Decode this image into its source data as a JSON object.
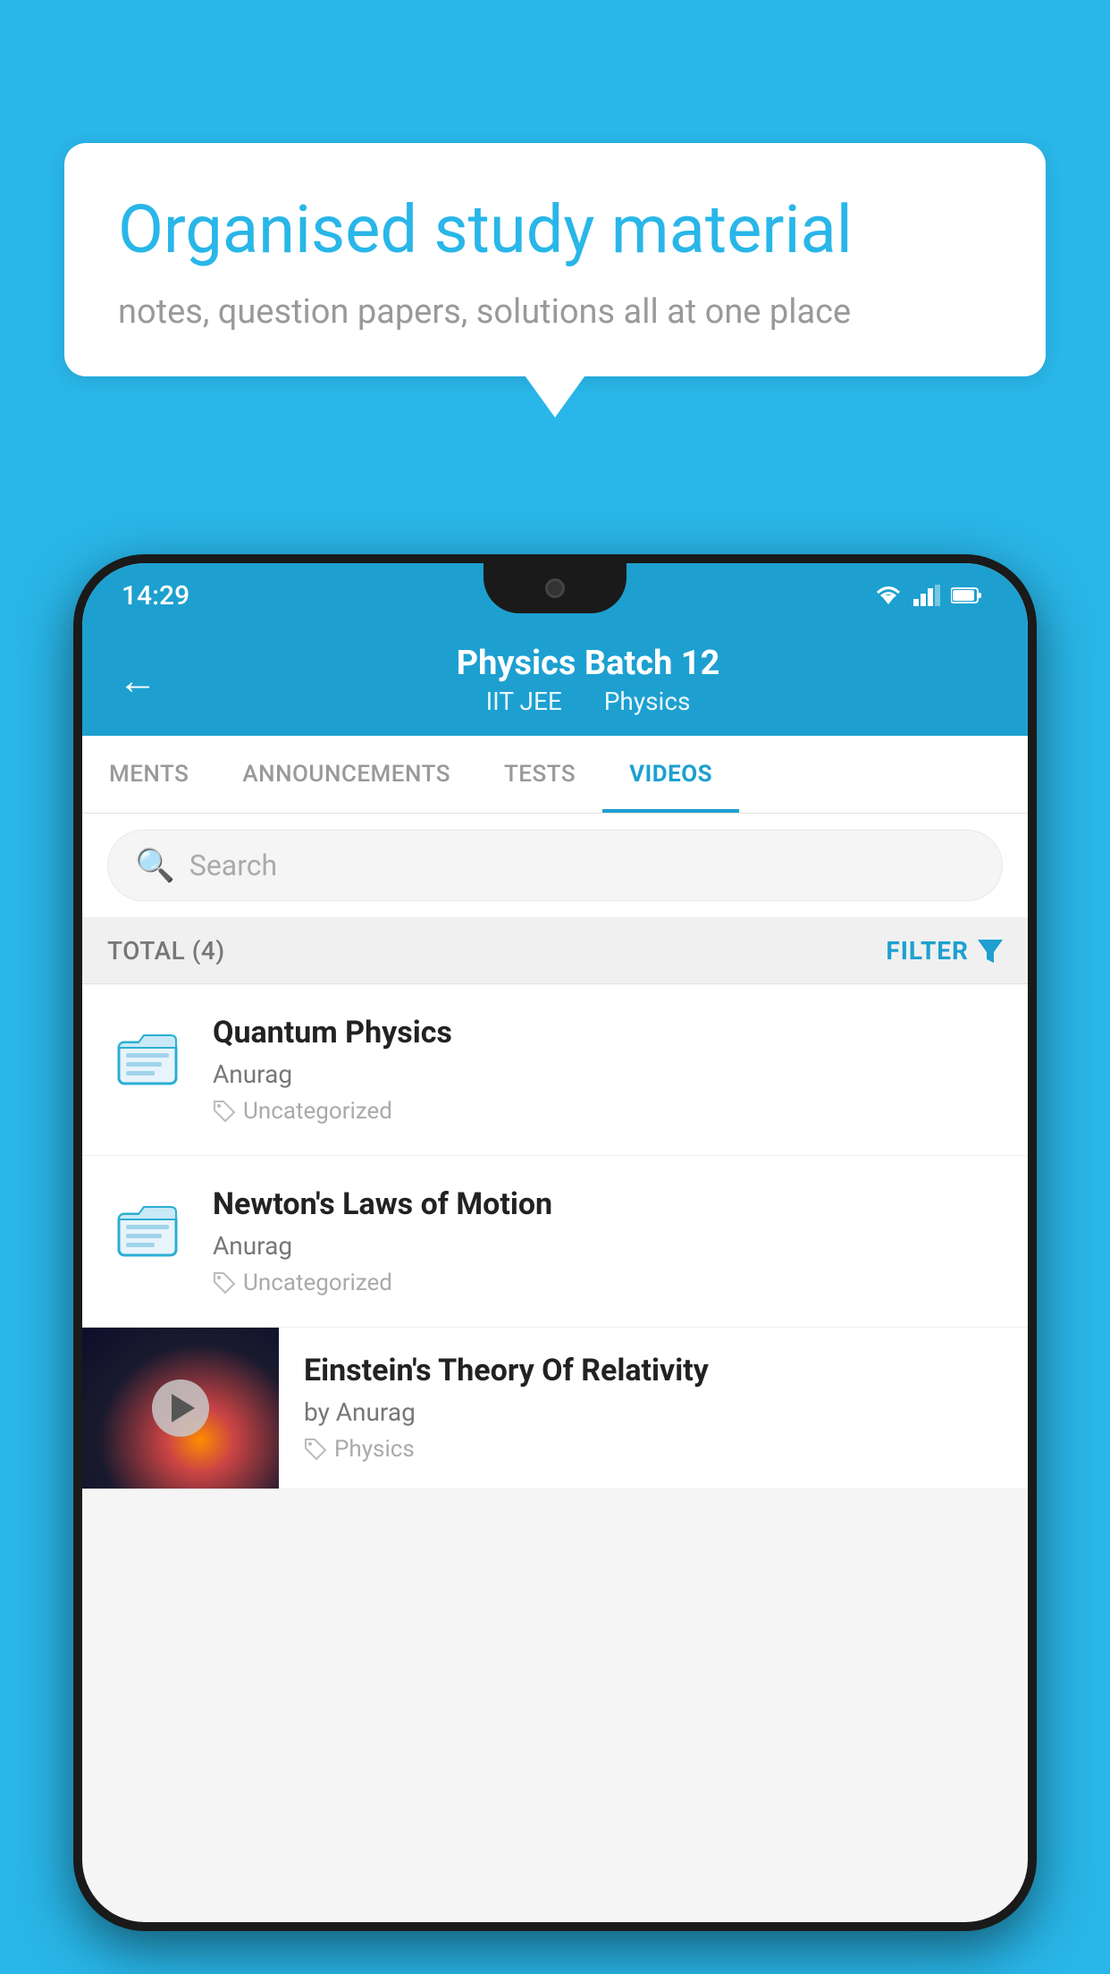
{
  "background_color": "#29b6e8",
  "bubble": {
    "title": "Organised study material",
    "subtitle": "notes, question papers, solutions all at one place"
  },
  "status_bar": {
    "time": "14:29",
    "wifi": "▾",
    "signal": "◂",
    "battery": "▮"
  },
  "header": {
    "title": "Physics Batch 12",
    "subtitle_left": "IIT JEE",
    "subtitle_right": "Physics",
    "back_label": "←"
  },
  "tabs": [
    {
      "label": "MENTS",
      "active": false
    },
    {
      "label": "ANNOUNCEMENTS",
      "active": false
    },
    {
      "label": "TESTS",
      "active": false
    },
    {
      "label": "VIDEOS",
      "active": true
    }
  ],
  "search": {
    "placeholder": "Search"
  },
  "filter_bar": {
    "total_label": "TOTAL (4)",
    "filter_label": "FILTER"
  },
  "videos": [
    {
      "id": 1,
      "title": "Quantum Physics",
      "author": "Anurag",
      "tag": "Uncategorized",
      "has_thumb": false
    },
    {
      "id": 2,
      "title": "Newton's Laws of Motion",
      "author": "Anurag",
      "tag": "Uncategorized",
      "has_thumb": false
    },
    {
      "id": 3,
      "title": "Einstein's Theory Of Relativity",
      "author": "by Anurag",
      "tag": "Physics",
      "has_thumb": true
    }
  ]
}
